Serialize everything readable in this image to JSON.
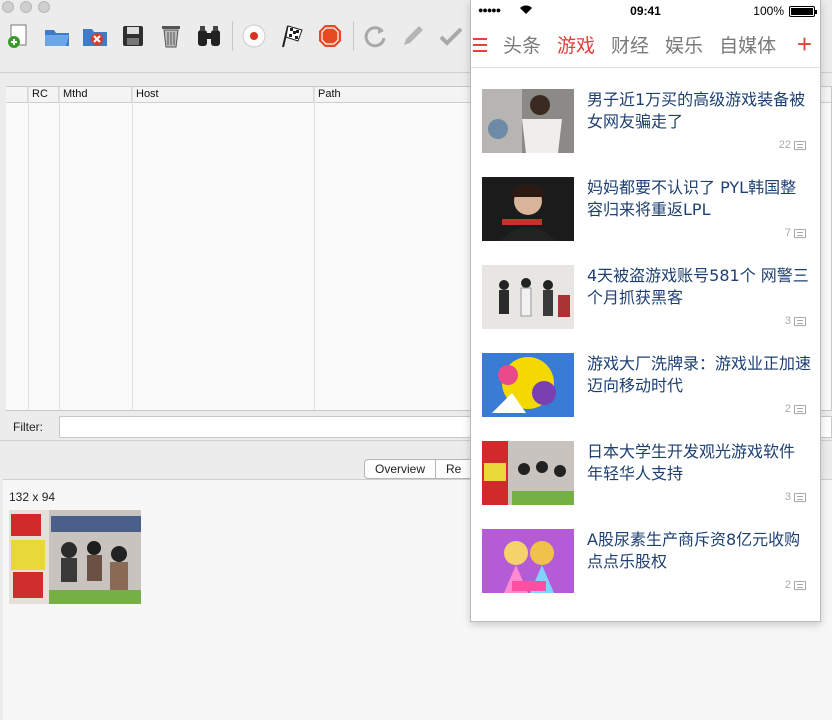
{
  "proxy_app": {
    "columns": [
      "RC",
      "Mthd",
      "Host",
      "Path"
    ],
    "filter_label": "Filter:",
    "tabs": [
      "Overview",
      "Re"
    ],
    "preview_dimensions": "132 x 94",
    "toolbar_icons": [
      "add-icon",
      "open-folder-icon",
      "delete-icon",
      "save-icon",
      "trash-icon",
      "binoculars-icon",
      "record-icon",
      "checkered-flag-icon",
      "stop-icon",
      "refresh-icon",
      "pencil-icon",
      "checkmark-icon"
    ]
  },
  "phone": {
    "status_bar": {
      "signal": "●●●●●",
      "time": "09:41",
      "battery": "100%"
    },
    "nav": {
      "tabs": [
        "头条",
        "游戏",
        "财经",
        "娱乐",
        "自媒体"
      ],
      "active_tab": "游戏",
      "plus": "+"
    },
    "feed": [
      {
        "title": "男子近1万买的高级游戏装备被女网友骗走了",
        "comments": "22"
      },
      {
        "title": "妈妈都要不认识了 PYL韩国整容归来将重返LPL",
        "comments": "7"
      },
      {
        "title": "4天被盗游戏账号581个 网警三个月抓获黑客",
        "comments": "3"
      },
      {
        "title": "游戏大厂洗牌录：游戏业正加速迈向移动时代",
        "comments": "2"
      },
      {
        "title": "日本大学生开发观光游戏软件 年轻华人支持",
        "comments": "3"
      },
      {
        "title": "A股尿素生产商斥资8亿元收购点点乐股权",
        "comments": "2"
      }
    ],
    "accent_color": "#e0423a",
    "title_color": "#1d3f72"
  }
}
